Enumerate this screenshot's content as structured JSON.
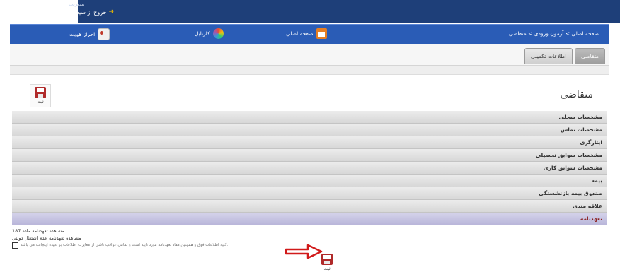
{
  "header": {
    "logout_label": "خروج از سیستم",
    "user_label": "مدیریت"
  },
  "nav": {
    "breadcrumb": "صفحه اصلی > آزمون ورودی > متقاضی",
    "home_label": "صفحه اصلی",
    "cartable_label": "کارتابل",
    "auth_label": "احراز هویت"
  },
  "tabs": [
    "متقاضی",
    "اطلاعات تکمیلی"
  ],
  "page": {
    "title": "متقاضی",
    "save_label": "ثبت"
  },
  "sections": [
    "مشخصات سجلی",
    "مشخصات تماس",
    "ایثارگری",
    "مشخصات سوابق تحصیلی",
    "مشخصات سوابق کاری",
    "بیمه",
    "صندوق بیمه بازنشستگی",
    "علاقه مندی",
    "تعهدنامه"
  ],
  "commitment": {
    "line1": "مشاهده تعهدنامه ماده 187",
    "line2": "مشاهده تعهدنامه عدم اشتغال دولتی",
    "checkbox_text": "کلیه اطلاعات فوق و همچنین مفاد تعهدنامه مورد تایید است و تمامی عواقب ناشی از مغایرت اطلاعات بر عهده اینجانب می باشد."
  },
  "colors": {
    "topbar": "#1e3f79",
    "navbar": "#2a5cb6",
    "active_section": "#b9b6da",
    "accent_red": "#b02a2a"
  }
}
